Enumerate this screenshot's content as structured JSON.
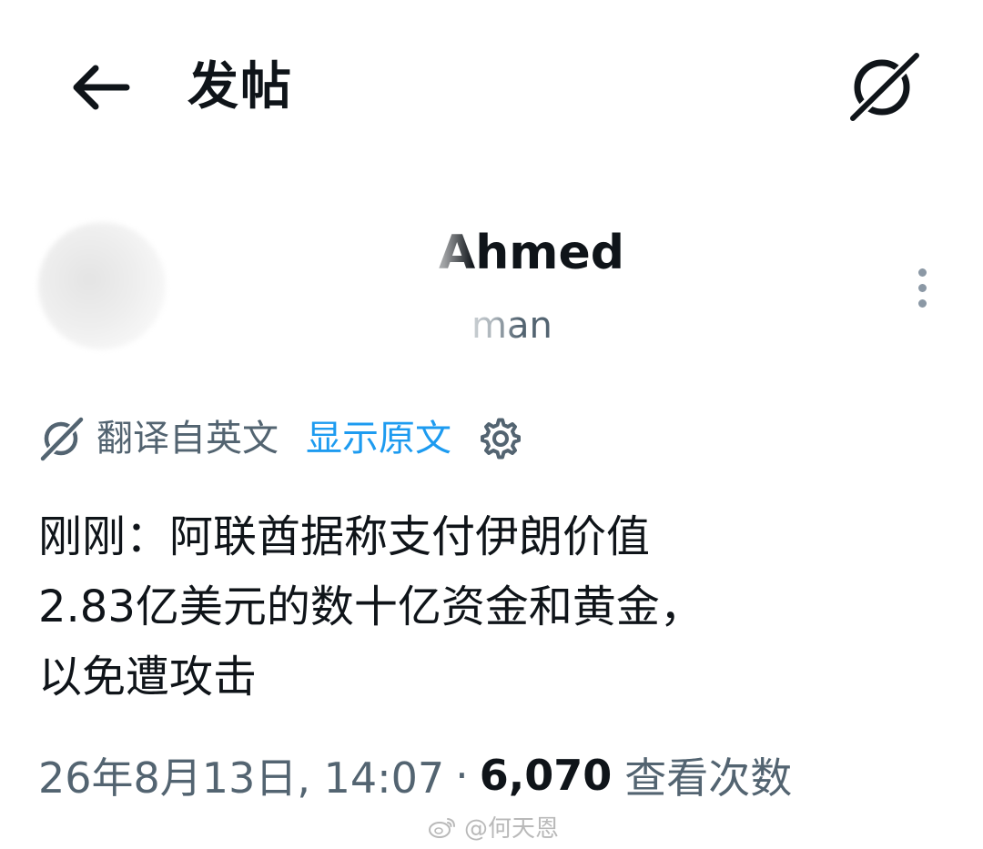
{
  "header": {
    "back_icon": "arrow-left-icon",
    "title": "发帖",
    "grok_icon": "grok-icon"
  },
  "author": {
    "name": "Ahmed",
    "handle": "man",
    "more_icon": "more-vertical-icon"
  },
  "translation": {
    "icon": "grok-icon",
    "label": "翻译自英文",
    "show_original": "显示原文",
    "settings_icon": "gear-icon"
  },
  "post": {
    "text": "刚刚：阿联酋据称支付伊朗价值\n2.83亿美元的数十亿资金和黄金，\n以免遭攻击"
  },
  "meta": {
    "timestamp": "26年8月13日, 14:07",
    "separator": "·",
    "view_count": "6,070",
    "views_label": "查看次数"
  },
  "watermark": {
    "icon": "weibo-icon",
    "text": "@何天恩"
  },
  "colors": {
    "text_primary": "#0f1419",
    "text_secondary": "#536471",
    "link": "#1d9bf0",
    "background": "#ffffff"
  }
}
